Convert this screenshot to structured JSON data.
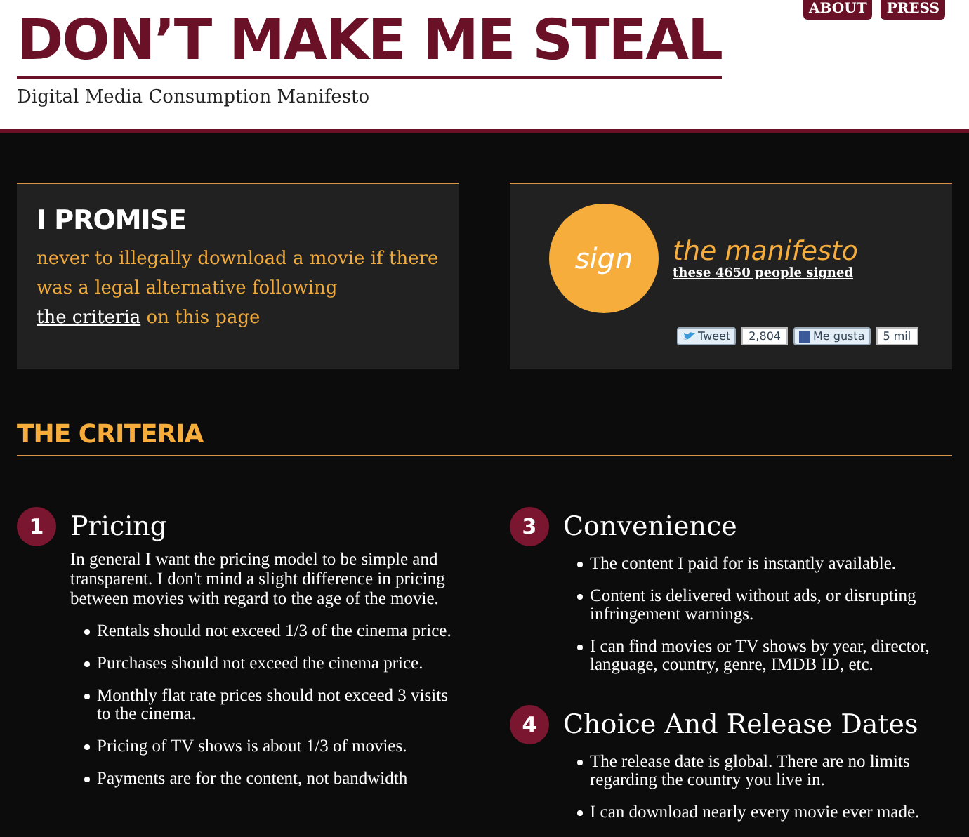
{
  "nav": [
    "ABOUT",
    "PRESS"
  ],
  "title": "DON’T MAKE ME STEAL",
  "subtitle": "Digital Media Consumption Manifesto",
  "promise": {
    "heading": "I PROMISE",
    "text_before": "never to illegally download a movie if there was a legal alternative following",
    "link": "the criteria",
    "text_after": "on this page"
  },
  "sign": {
    "badge": "sign",
    "heading": "the manifesto",
    "link": "these 4650 people signed",
    "tweet": "Tweet",
    "tweet_count": "2,804",
    "like": "Me gusta",
    "like_count": "5 mil"
  },
  "criteria_heading": "THE CRITERIA",
  "columns": [
    [
      {
        "number": "1",
        "title": "Pricing",
        "intro": "In general I want the pricing model to be simple and transparent. I don't mind a slight difference in pricing between movies with regard to the age of the movie.",
        "bullets": [
          "Rentals should not exceed 1/3 of the cinema price.",
          "Purchases should not exceed the cinema price.",
          "Monthly flat rate prices should not exceed 3 visits to the cinema.",
          "Pricing of TV shows is about 1/3 of movies.",
          "Payments are for the content, not bandwidth"
        ]
      }
    ],
    [
      {
        "number": "3",
        "title": "Convenience",
        "bullets": [
          "The content I paid for is instantly available.",
          "Content is delivered without ads, or disrupting infringement warnings.",
          "I can find movies or TV shows by year, director, language, country, genre, IMDB ID, etc."
        ]
      },
      {
        "number": "4",
        "title": "Choice And Release Dates",
        "bullets": [
          "The release date is global. There are no limits regarding the country you live in.",
          "I can download nearly every movie ever made."
        ]
      }
    ]
  ]
}
